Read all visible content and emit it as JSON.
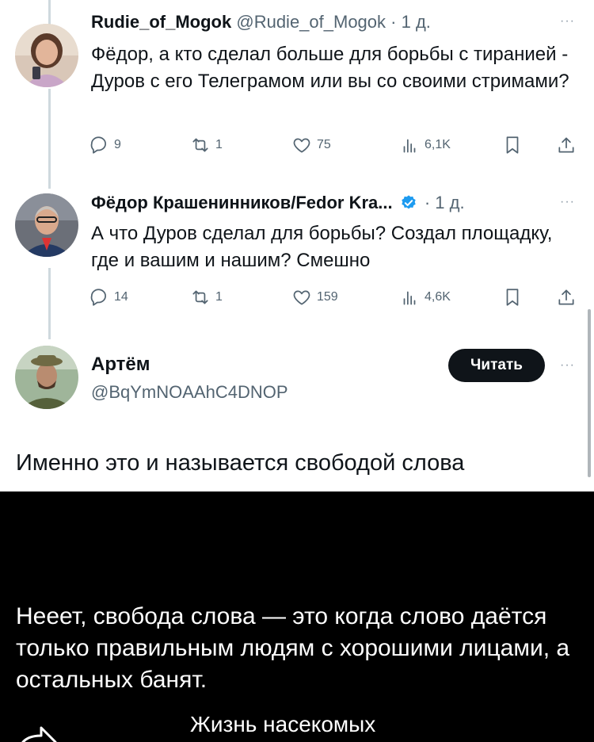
{
  "tweets": [
    {
      "name": "Rudie_of_Mogok",
      "handle": "@Rudie_of_Mogok",
      "time": "· 1 д.",
      "text": "Фёдор, а кто сделал больше для борьбы с тиранией - Дуров с его Телеграмом или вы со своими стримами?",
      "replies": "9",
      "reposts": "1",
      "likes": "75",
      "views": "6,1K",
      "more": "···"
    },
    {
      "name": "Фёдор Крашенинников/Fedor Kra...",
      "time": "· 1 д.",
      "verified": true,
      "text": "А что Дуров сделал для борьбы? Создал площадку, где и вашим и нашим? Смешно",
      "replies": "14",
      "reposts": "1",
      "likes": "159",
      "views": "4,6K",
      "more": "···"
    },
    {
      "name": "Артём",
      "handle": "@BqYmNOAAhC4DNOP",
      "follow_label": "Читать",
      "text": "Именно это и называется свободой слова",
      "more": "···"
    }
  ],
  "caption": "Нееет, свобода слова — это когда слово даётся только правильным людям с хорошими лицами, а остальных банят.",
  "channel": "Жизнь насекомых",
  "colors": {
    "text": "#0f1419",
    "secondary": "#536471",
    "verified": "#1d9bf0",
    "follow_bg": "#0f1419",
    "dark_bg": "#000000"
  },
  "icons": [
    "reply-icon",
    "repost-icon",
    "like-icon",
    "views-icon",
    "bookmark-icon",
    "share-icon",
    "verified-badge-icon",
    "forward-arrow-icon"
  ]
}
